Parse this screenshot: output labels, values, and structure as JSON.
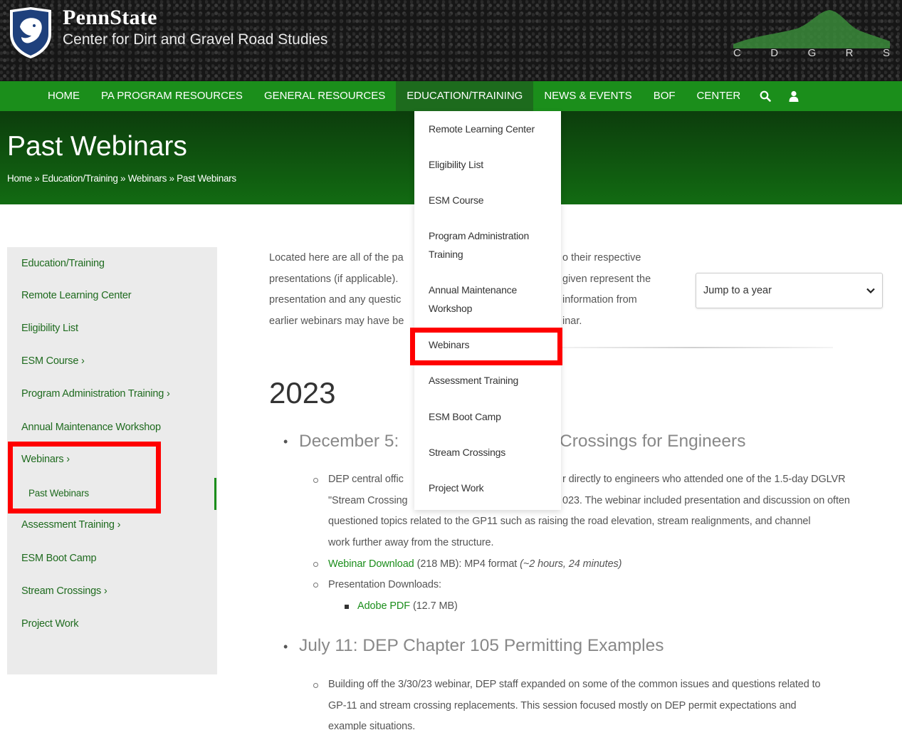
{
  "header": {
    "brand_name": "PennState",
    "brand_sub": "Center for Dirt and Gravel Road Studies",
    "letters": [
      "C",
      "D",
      "G",
      "R",
      "S"
    ]
  },
  "nav": {
    "items": [
      "HOME",
      "PA PROGRAM RESOURCES",
      "GENERAL RESOURCES",
      "EDUCATION/TRAINING",
      "NEWS & EVENTS",
      "BOF",
      "CENTER"
    ],
    "active_index": 3,
    "search_icon": "search-icon",
    "user_icon": "user-icon"
  },
  "hero": {
    "title": "Past Webinars",
    "breadcrumb": "Home » Education/Training » Webinars » Past Webinars"
  },
  "dropdown": {
    "items": [
      "Remote Learning Center",
      "Eligibility List",
      "ESM Course",
      "Program Administration Training",
      "Annual Maintenance Workshop",
      "Webinars",
      "Assessment Training",
      "ESM Boot Camp",
      "Stream Crossings",
      "Project Work"
    ],
    "highlighted": "Webinars"
  },
  "sidebar": {
    "items": [
      "Education/Training",
      "Remote Learning Center",
      "Eligibility List",
      "ESM Course ›",
      "Program Administration Training ›",
      "Annual Maintenance Workshop",
      "Webinars ›",
      "Past Webinars",
      "Assessment Training ›",
      "ESM Boot Camp",
      "Stream Crossings ›",
      "Project Work"
    ],
    "active": "Past Webinars"
  },
  "main": {
    "intro_left": [
      "Located here are all of the pa",
      "presentations (if applicable).",
      "presentation and any questic",
      "earlier webinars may have be"
    ],
    "intro_right": [
      "o their respective",
      "given represent the",
      " information from",
      "inar."
    ],
    "year_select": "Jump to a year",
    "year": "2023",
    "webinars": [
      {
        "title_left": "December 5:",
        "title_right": "Crossings for Engineers",
        "desc_lines": [
          "DEP central offic",
          "\"Stream Crossing",
          "questioned topics related to the GP11 such as raising the road elevation, stream realignments, and channel",
          "work further away from the structure."
        ],
        "desc_right_lines": [
          "r directly to engineers who attended one of the 1.5-day DGLVR",
          "023. The webinar included presentation and discussion on often"
        ],
        "download_link": "Webinar Download",
        "download_text": " (218 MB): MP4 format ",
        "download_duration": "(~2 hours, 24 minutes)",
        "presentation_label": "Presentation Downloads:",
        "pdf_link": "Adobe PDF",
        "pdf_size": " (12.7 MB)"
      },
      {
        "title_left": "July 11: DEP Chapter 105 Permitting Examples",
        "desc_lines": [
          "Building off the 3/30/23 webinar, DEP staff expanded on some of the common issues and questions related to",
          "GP-11 and stream crossing replacements. This session focused mostly on DEP permit expectations and",
          "example situations."
        ]
      }
    ]
  }
}
